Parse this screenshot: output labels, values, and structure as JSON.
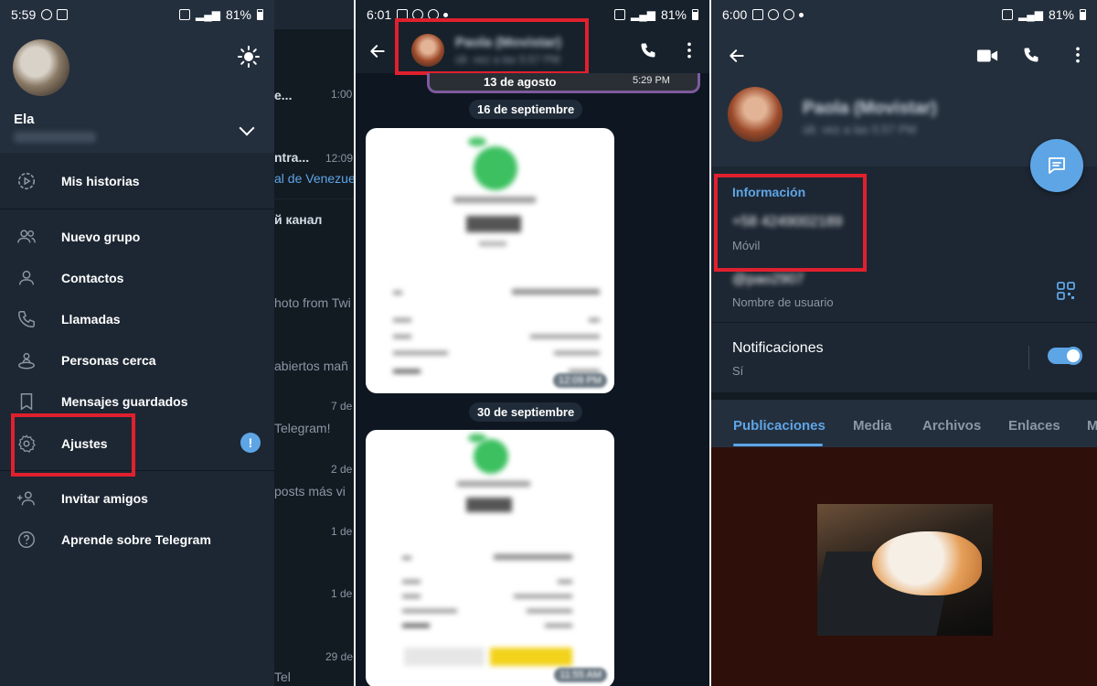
{
  "panel1": {
    "status": {
      "time": "5:59",
      "battery": "81%"
    },
    "user": {
      "name": "Ela"
    },
    "chats": [
      {
        "text": "e...",
        "meta": "1:00"
      },
      {
        "text": "ntra...",
        "meta": "12:09"
      },
      {
        "text": "al de Venezue",
        "meta": ""
      },
      {
        "text": "й канал",
        "meta": ""
      },
      {
        "text": "hoto from Twi",
        "meta": ""
      },
      {
        "text": "abiertos mañ",
        "meta": ""
      },
      {
        "text": "Telegram!",
        "meta": "7 de"
      },
      {
        "text": "posts más vi",
        "meta": "2 de"
      },
      {
        "text": "",
        "meta": "1 de"
      },
      {
        "text": "",
        "meta": "1 de"
      },
      {
        "text": "Tel",
        "meta": "29 de"
      }
    ],
    "menu": {
      "stories": "Mis historias",
      "new_group": "Nuevo grupo",
      "contacts": "Contactos",
      "calls": "Llamadas",
      "nearby": "Personas cerca",
      "saved": "Mensajes guardados",
      "settings": "Ajustes",
      "settings_badge": "!",
      "invite": "Invitar amigos",
      "learn": "Aprende sobre Telegram"
    }
  },
  "panel2": {
    "status": {
      "time": "6:01",
      "battery": "81%"
    },
    "header": {
      "name": "Paola (Movistar)",
      "status": "últ. vez a las 5:57 PM"
    },
    "top_pill": "13 de agosto",
    "top_time": "5:29 PM",
    "date1": "16 de septiembre",
    "date2": "30 de septiembre",
    "msg1_time": "12:09 PM",
    "msg2_time": "11:55 AM"
  },
  "panel3": {
    "status": {
      "time": "6:00",
      "battery": "81%"
    },
    "header": {
      "name": "Paola (Movistar)",
      "status": "últ. vez a las 5:57 PM"
    },
    "info_title": "Información",
    "phone": "+58 4249002189",
    "phone_label": "Móvil",
    "username": "@pao2907",
    "username_label": "Nombre de usuario",
    "notif_title": "Notificaciones",
    "notif_value": "Sí",
    "tabs": [
      "Publicaciones",
      "Media",
      "Archivos",
      "Enlaces",
      "M"
    ]
  },
  "colors": {
    "accent": "#5ea5e6",
    "highlight": "#e0202e",
    "bg": "#1d2733"
  }
}
